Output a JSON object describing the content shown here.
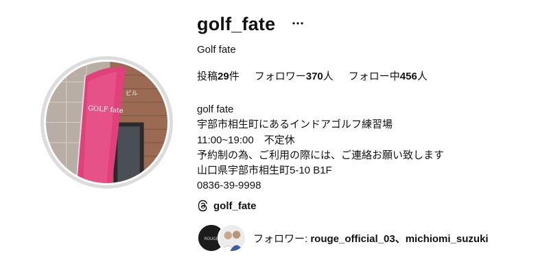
{
  "profile": {
    "username": "golf_fate",
    "full_name": "Golf fate",
    "more_icon": "more-horizontal-icon",
    "stats": {
      "posts_prefix": "投稿",
      "posts_count": "29",
      "posts_suffix": "件",
      "followers_prefix": "フォロワー",
      "followers_count": "370",
      "followers_suffix": "人",
      "following_prefix": "フォロー中",
      "following_count": "456",
      "following_suffix": "人"
    },
    "bio_lines": [
      "golf fate",
      "宇部市相生町にあるインドアゴルフ練習場",
      "11:00~19:00　不定休",
      "予約制の為、ご利用の際には、ご連絡お願い致します",
      "山口県宇部市相生町5-10 B1F",
      "0836-39-9998"
    ],
    "threads": {
      "icon": "threads-icon",
      "handle": "golf_fate"
    },
    "followed_by": {
      "prefix": "フォロワー: ",
      "names": "rouge_official_03、michiomi_suzuki",
      "avatar1_label": "ROUGE"
    },
    "avatar_sign": {
      "text": "GOLF fate",
      "building_text": "ビル"
    },
    "colors": {
      "flag_pink": "#e0417a",
      "avatar_ring": "#dcdcdc"
    }
  }
}
